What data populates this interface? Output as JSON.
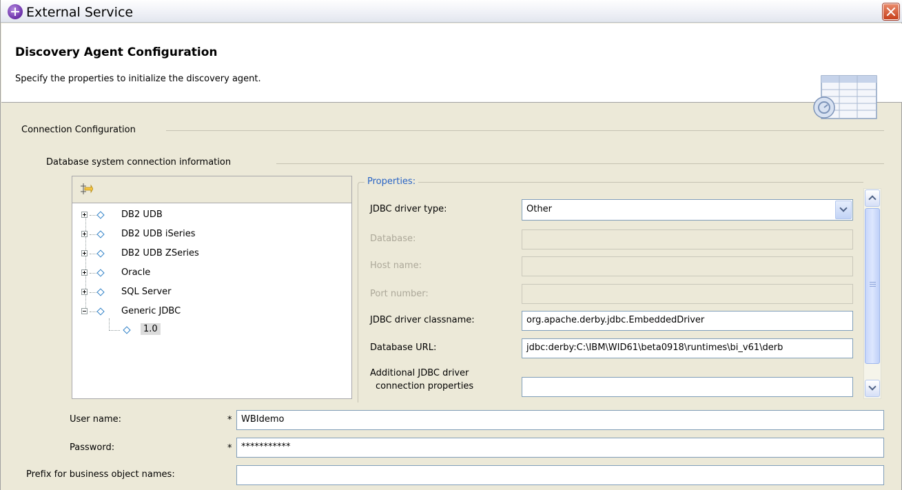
{
  "window": {
    "title": "External Service"
  },
  "header": {
    "title": "Discovery Agent Configuration",
    "description": "Specify the properties to initialize the discovery agent."
  },
  "groups": {
    "connection_configuration": "Connection Configuration",
    "database_connection_info": "Database system connection information"
  },
  "tree": {
    "items": [
      {
        "label": "DB2 UDB",
        "expanded": false
      },
      {
        "label": "DB2 UDB iSeries",
        "expanded": false
      },
      {
        "label": "DB2 UDB ZSeries",
        "expanded": false
      },
      {
        "label": "Oracle",
        "expanded": false
      },
      {
        "label": "SQL Server",
        "expanded": false
      },
      {
        "label": "Generic JDBC",
        "expanded": true
      }
    ],
    "selected_child": "1.0"
  },
  "properties": {
    "title": "Properties:",
    "jdbc_driver_type": {
      "label": "JDBC driver type:",
      "value": "Other"
    },
    "database": {
      "label": "Database:",
      "value": ""
    },
    "host_name": {
      "label": "Host name:",
      "value": ""
    },
    "port_number": {
      "label": "Port number:",
      "value": ""
    },
    "jdbc_driver_classname": {
      "label": "JDBC driver classname:",
      "value": "org.apache.derby.jdbc.EmbeddedDriver"
    },
    "database_url": {
      "label": "Database URL:",
      "value": "jdbc:derby:C:\\IBM\\WID61\\beta0918\\runtimes\\bi_v61\\derb"
    },
    "additional_props": {
      "label_line1": "Additional JDBC driver",
      "label_line2": "connection properties",
      "value": ""
    }
  },
  "credentials": {
    "user_name": {
      "label": "User name:",
      "value": "WBIdemo",
      "required_mark": "*"
    },
    "password": {
      "label": "Password:",
      "value": "***********",
      "required_mark": "*"
    },
    "prefix": {
      "label": "Prefix for business object names:",
      "value": ""
    }
  },
  "colors": {
    "window_bg": "#ece9d8",
    "properties_title": "#2763c5",
    "disabled_text": "#aca899",
    "field_border": "#7f9db9"
  }
}
